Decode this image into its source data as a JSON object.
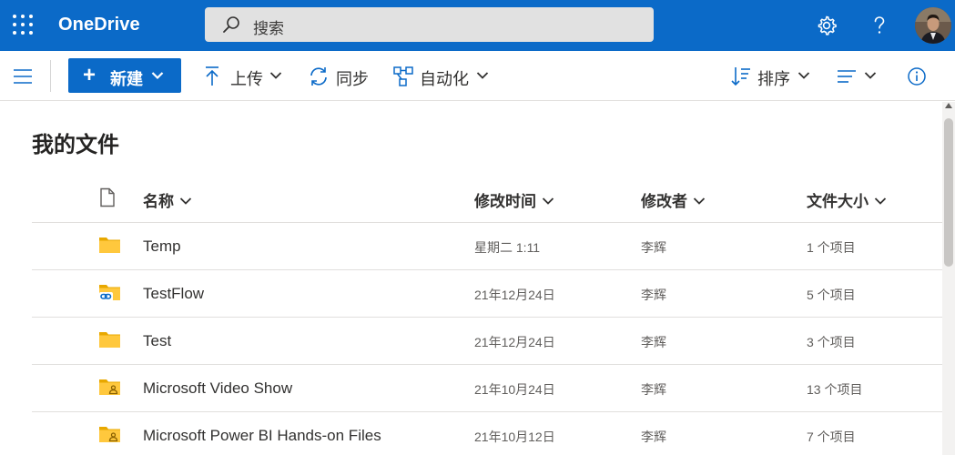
{
  "header": {
    "app_name": "OneDrive",
    "search_placeholder": "搜索",
    "icons": [
      "app-launcher-icon",
      "search-icon",
      "gear-icon",
      "help-icon",
      "avatar"
    ],
    "accent_color": "#0b6ac8"
  },
  "toolbar": {
    "new_label": "新建",
    "upload_label": "上传",
    "sync_label": "同步",
    "automate_label": "自动化",
    "sort_label": "排序"
  },
  "page": {
    "title": "我的文件"
  },
  "table": {
    "columns": {
      "name": "名称",
      "modified": "修改时间",
      "modified_by": "修改者",
      "size": "文件大小"
    },
    "rows": [
      {
        "icon": "folder-icon",
        "name": "Temp",
        "modified": "星期二 1:11",
        "modified_by": "李辉",
        "size": "1 个项目"
      },
      {
        "icon": "shared-link-folder-icon",
        "name": "TestFlow",
        "modified": "21年12月24日",
        "modified_by": "李辉",
        "size": "5 个项目"
      },
      {
        "icon": "folder-icon",
        "name": "Test",
        "modified": "21年12月24日",
        "modified_by": "李辉",
        "size": "3 个项目"
      },
      {
        "icon": "shared-people-folder-icon",
        "name": "Microsoft Video Show",
        "modified": "21年10月24日",
        "modified_by": "李辉",
        "size": "13 个项目"
      },
      {
        "icon": "shared-people-folder-icon",
        "name": "Microsoft Power BI Hands-on Files",
        "modified": "21年10月12日",
        "modified_by": "李辉",
        "size": "7 个项目"
      }
    ]
  }
}
